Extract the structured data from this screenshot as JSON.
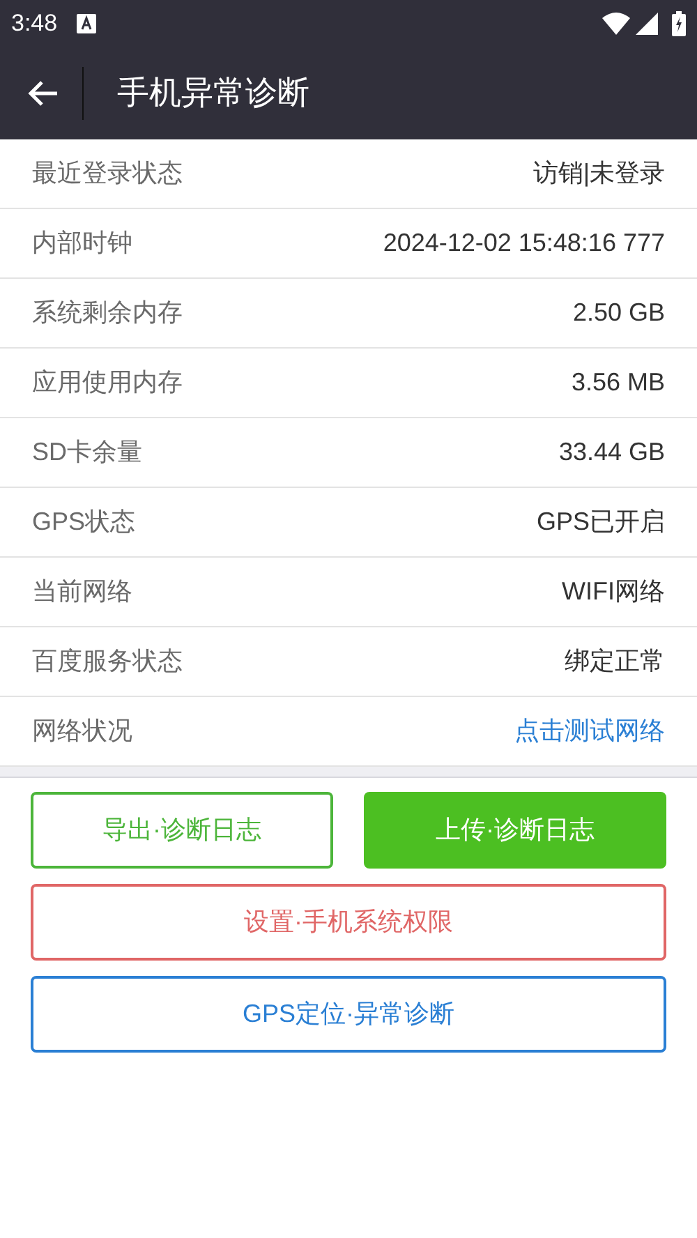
{
  "status_bar": {
    "time": "3:48"
  },
  "app_bar": {
    "title": "手机异常诊断"
  },
  "rows": [
    {
      "label": "最近登录状态",
      "value": "访销|未登录",
      "kind": "text"
    },
    {
      "label": "内部时钟",
      "value": "2024-12-02 15:48:16 777",
      "kind": "text"
    },
    {
      "label": "系统剩余内存",
      "value": "2.50 GB",
      "kind": "text"
    },
    {
      "label": "应用使用内存",
      "value": "3.56 MB",
      "kind": "text"
    },
    {
      "label": "SD卡余量",
      "value": "33.44 GB",
      "kind": "text"
    },
    {
      "label": "GPS状态",
      "value": "GPS已开启",
      "kind": "text"
    },
    {
      "label": "当前网络",
      "value": "WIFI网络",
      "kind": "text"
    },
    {
      "label": "百度服务状态",
      "value": "绑定正常",
      "kind": "text"
    },
    {
      "label": "网络状况",
      "value": "点击测试网络",
      "kind": "link"
    }
  ],
  "buttons": [
    {
      "label": "导出·诊断日志",
      "kind": "outline",
      "color": "#4cb53a"
    },
    {
      "label": "上传·诊断日志",
      "kind": "filled",
      "color": "#4cbf22"
    },
    {
      "label": "设置·手机系统权限",
      "kind": "outline",
      "color": "#e06666"
    },
    {
      "label": "GPS定位·异常诊断",
      "kind": "outline",
      "color": "#2a7fd4"
    }
  ]
}
